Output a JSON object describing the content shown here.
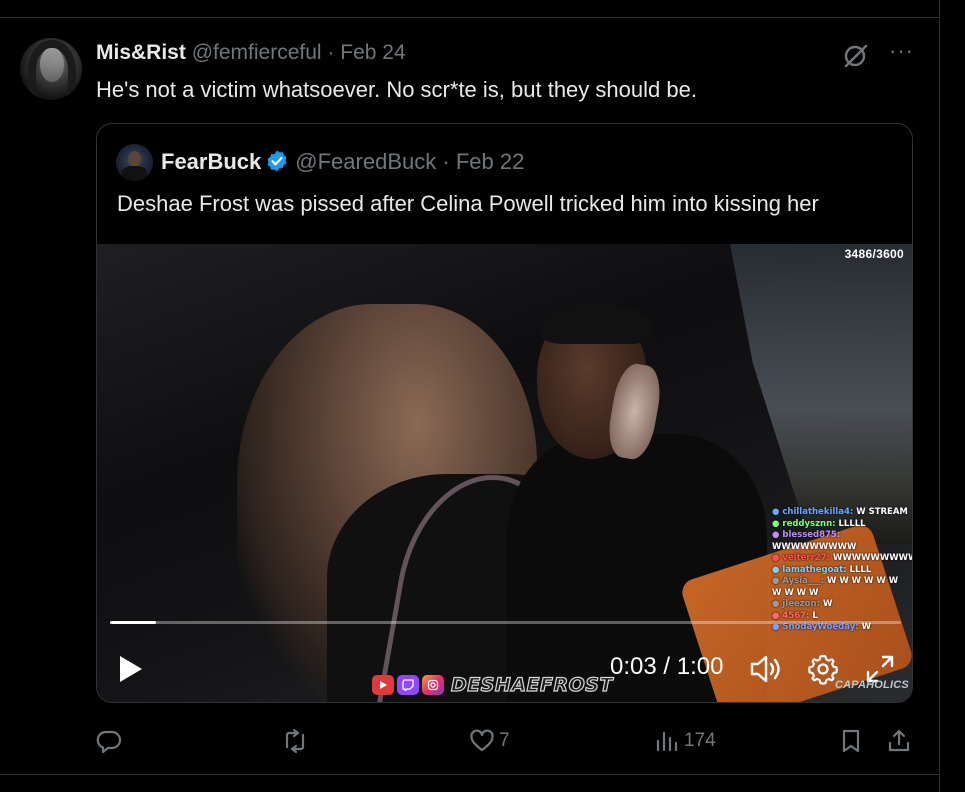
{
  "post": {
    "author_name": "Mis&Rist",
    "author_handle": "@femfierceful",
    "separator": "·",
    "date": "Feb 24",
    "text": "He's not a victim whatsoever. No scr*te is, but they should be.",
    "more_label": "···"
  },
  "quote": {
    "author_name": "FearBuck",
    "author_handle": "@FearedBuck",
    "separator": "·",
    "date": "Feb 22",
    "verified": true,
    "text": "Deshae Frost was pissed after Celina Powell tricked him into kissing her"
  },
  "video": {
    "overlay_counter": "3486/3600",
    "current_time": "0:03",
    "time_separator": " / ",
    "duration": "1:00",
    "progress_fraction": 0.058,
    "watermark": "DESHAEFROST",
    "corner_logo": "CAPAHOLICS",
    "chat": [
      {
        "user": "chillathekilla4:",
        "msg": "W STREAM",
        "cls": "u1"
      },
      {
        "user": "reddysznn:",
        "msg": "LLLLL",
        "cls": "u2"
      },
      {
        "user": "blessed875:",
        "msg": "",
        "cls": "u3"
      },
      {
        "user": "",
        "msg": "WWWWWWWWW",
        "cls": "u1"
      },
      {
        "user": "veiterr27:",
        "msg": "WWWWWWWWW",
        "cls": "u4"
      },
      {
        "user": "lamathegoat:",
        "msg": "LLLL",
        "cls": "u5"
      },
      {
        "user": "Aysia___:",
        "msg": "W W W W W W",
        "cls": "u6"
      },
      {
        "user": "",
        "msg": "W W   W W",
        "cls": "u6"
      },
      {
        "user": "jleezon:",
        "msg": "W",
        "cls": "u6"
      },
      {
        "user": "4567:",
        "msg": "L",
        "cls": "u7"
      },
      {
        "user": "SnodayWoeday:",
        "msg": "W",
        "cls": "u8"
      }
    ]
  },
  "actions": {
    "replies": "",
    "reposts": "",
    "likes": "7",
    "views": "174"
  },
  "colors": {
    "background": "#000000",
    "text_primary": "#e7e9ea",
    "text_secondary": "#71767b",
    "border": "#2f3336",
    "verified_blue": "#1d9bf0"
  },
  "icons": [
    "grok-icon",
    "more-icon",
    "verified-badge-icon",
    "play-icon",
    "volume-icon",
    "settings-gear-icon",
    "fullscreen-icon",
    "reply-icon",
    "repost-icon",
    "like-heart-icon",
    "views-chart-icon",
    "bookmark-icon",
    "share-icon"
  ]
}
